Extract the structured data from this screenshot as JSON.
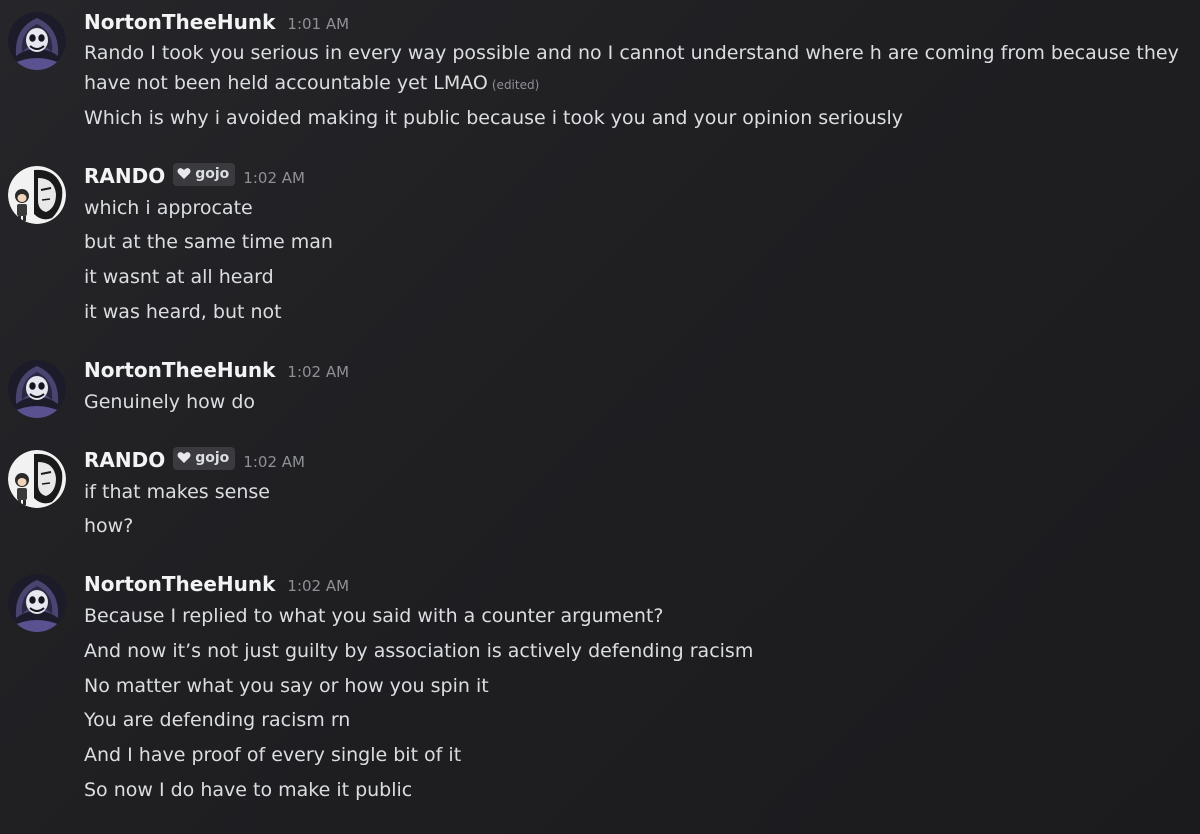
{
  "users": {
    "norton": {
      "name": "NortonTheeHunk",
      "avatar": "skull-hood-avatar"
    },
    "rando": {
      "name": "RANDO",
      "avatar": "anime-duo-avatar",
      "tag": {
        "icon": "heart-icon",
        "label": "gojo"
      }
    }
  },
  "messages": [
    {
      "author": "NortonTheeHunk",
      "time": "1:01 AM",
      "lines": [
        "Rando I took you serious in every way possible and no I cannot understand where h are coming from because they",
        "have not been held accountable yet LMAO",
        "Which is why i avoided making it public because i took you and your opinion seriously"
      ],
      "edited_label": "(edited)"
    },
    {
      "author": "RANDO",
      "tag": "gojo",
      "time": "1:02 AM",
      "lines": [
        "which i approcate",
        "but at the same time man",
        "it wasnt at all heard",
        "it was heard, but not"
      ]
    },
    {
      "author": "NortonTheeHunk",
      "time": "1:02 AM",
      "lines": [
        "Genuinely how do"
      ]
    },
    {
      "author": "RANDO",
      "tag": "gojo",
      "time": "1:02 AM",
      "lines": [
        "if that makes sense",
        "how?"
      ]
    },
    {
      "author": "NortonTheeHunk",
      "time": "1:02 AM",
      "lines": [
        "Because I replied to what you said with a counter argument?",
        "And now it’s not just guilty by association is actively defending racism",
        "No matter what you say or how you spin it",
        "You are defending racism rn",
        "And I have proof of every single bit of it",
        "So now I do have to make it public"
      ]
    }
  ]
}
